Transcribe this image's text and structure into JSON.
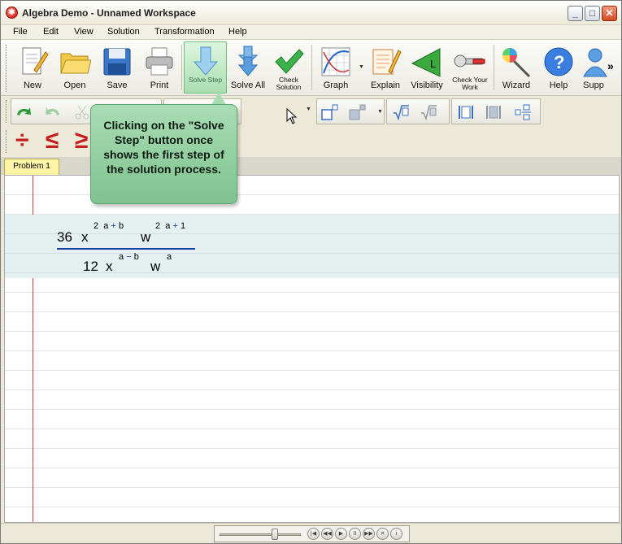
{
  "window": {
    "title": "Algebra Demo - Unnamed Workspace",
    "controls": {
      "minimize": "_",
      "maximize": "□",
      "close": "✕"
    }
  },
  "menu": [
    "File",
    "Edit",
    "View",
    "Solution",
    "Transformation",
    "Help"
  ],
  "toolbar1": {
    "new": "New",
    "open": "Open",
    "save": "Save",
    "print": "Print",
    "solve_step": "Solve Step",
    "solve_all": "Solve All",
    "check_solution": "Check Solution",
    "graph": "Graph",
    "explain": "Explain",
    "visibility": "Visibility",
    "check_your_work": "Check Your Work",
    "wizard": "Wizard",
    "help": "Help",
    "support": "Supp",
    "more": "»"
  },
  "toolbar3": {
    "divide": "÷",
    "less_equal": "≤",
    "greater_equal": "≥"
  },
  "tabs": [
    "Problem 1"
  ],
  "expression": {
    "numerator": {
      "coef": "36",
      "var1": "x",
      "exp1": [
        "2",
        "a",
        "+",
        "b"
      ],
      "var2": "w",
      "exp2": [
        "2",
        "a",
        "+",
        "1"
      ]
    },
    "denominator": {
      "coef": "12",
      "var1": "x",
      "exp1": [
        "a",
        "−",
        "b"
      ],
      "var2": "w",
      "exp2": [
        "a"
      ]
    }
  },
  "callout": {
    "text": "Clicking on the \"Solve Step\" button once shows the first step of the solution process."
  },
  "colors": {
    "callout_bg": "#a9dcb3",
    "margin_line": "#d23a3a",
    "fraction_bar": "#1a3ea8",
    "tab_bg": "#fdf5a6"
  }
}
